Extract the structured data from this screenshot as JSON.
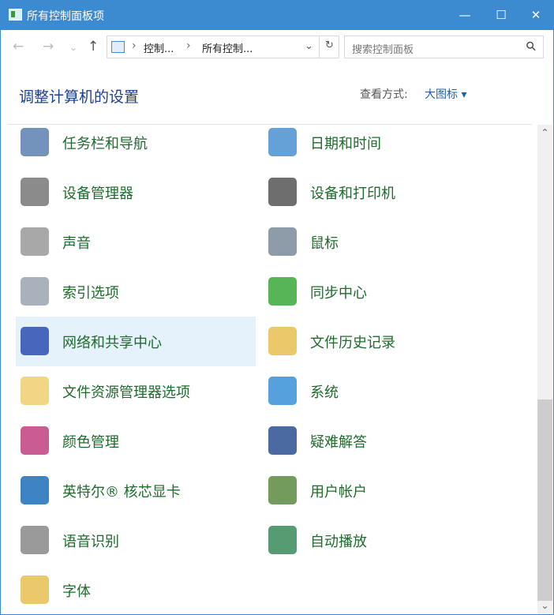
{
  "window": {
    "title": "所有控制面板项",
    "minimize": "—",
    "maximize": "☐",
    "close": "✕"
  },
  "nav": {
    "back": "←",
    "forward": "→",
    "recent": "⌄",
    "up": "↑",
    "refresh": "↻",
    "dropdown": "⌄"
  },
  "breadcrumb": [
    "控制...",
    "所有控制..."
  ],
  "breadcrumb_sep": "›",
  "search": {
    "placeholder": "搜索控制面板",
    "icon": "⚲"
  },
  "heading": "调整计算机的设置",
  "view": {
    "label": "查看方式:",
    "value": "大图标 ▾"
  },
  "items": [
    {
      "label": "任务栏和导航",
      "icon": "taskbar-icon",
      "color": "#5a7fb0"
    },
    {
      "label": "日期和时间",
      "icon": "calendar-clock-icon",
      "color": "#4a90d0"
    },
    {
      "label": "设备管理器",
      "icon": "device-manager-icon",
      "color": "#777777"
    },
    {
      "label": "设备和打印机",
      "icon": "printer-icon",
      "color": "#555555"
    },
    {
      "label": "声音",
      "icon": "speaker-icon",
      "color": "#999999"
    },
    {
      "label": "鼠标",
      "icon": "mouse-icon",
      "color": "#7a8a99"
    },
    {
      "label": "索引选项",
      "icon": "indexing-icon",
      "color": "#9aa5b0"
    },
    {
      "label": "同步中心",
      "icon": "sync-icon",
      "color": "#3aa83a"
    },
    {
      "label": "网络和共享中心",
      "icon": "network-icon",
      "color": "#2a4fb0",
      "highlighted": true
    },
    {
      "label": "文件历史记录",
      "icon": "file-history-icon",
      "color": "#e8c050"
    },
    {
      "label": "文件资源管理器选项",
      "icon": "folder-options-icon",
      "color": "#f0cf70"
    },
    {
      "label": "系统",
      "icon": "system-icon",
      "color": "#3a8fd8"
    },
    {
      "label": "颜色管理",
      "icon": "color-management-icon",
      "color": "#c04080"
    },
    {
      "label": "疑难解答",
      "icon": "troubleshoot-icon",
      "color": "#2a5090"
    },
    {
      "label": "英特尔® 核芯显卡",
      "icon": "intel-graphics-icon",
      "color": "#1a6fb8"
    },
    {
      "label": "用户帐户",
      "icon": "user-accounts-icon",
      "color": "#5a8a40"
    },
    {
      "label": "语音识别",
      "icon": "microphone-icon",
      "color": "#888888"
    },
    {
      "label": "自动播放",
      "icon": "autoplay-icon",
      "color": "#3a8a5a"
    },
    {
      "label": "字体",
      "icon": "fonts-icon",
      "color": "#e8c050"
    }
  ],
  "scrollbar": {
    "up": "⌃",
    "down": "⌄",
    "position_fraction": 0.74
  }
}
